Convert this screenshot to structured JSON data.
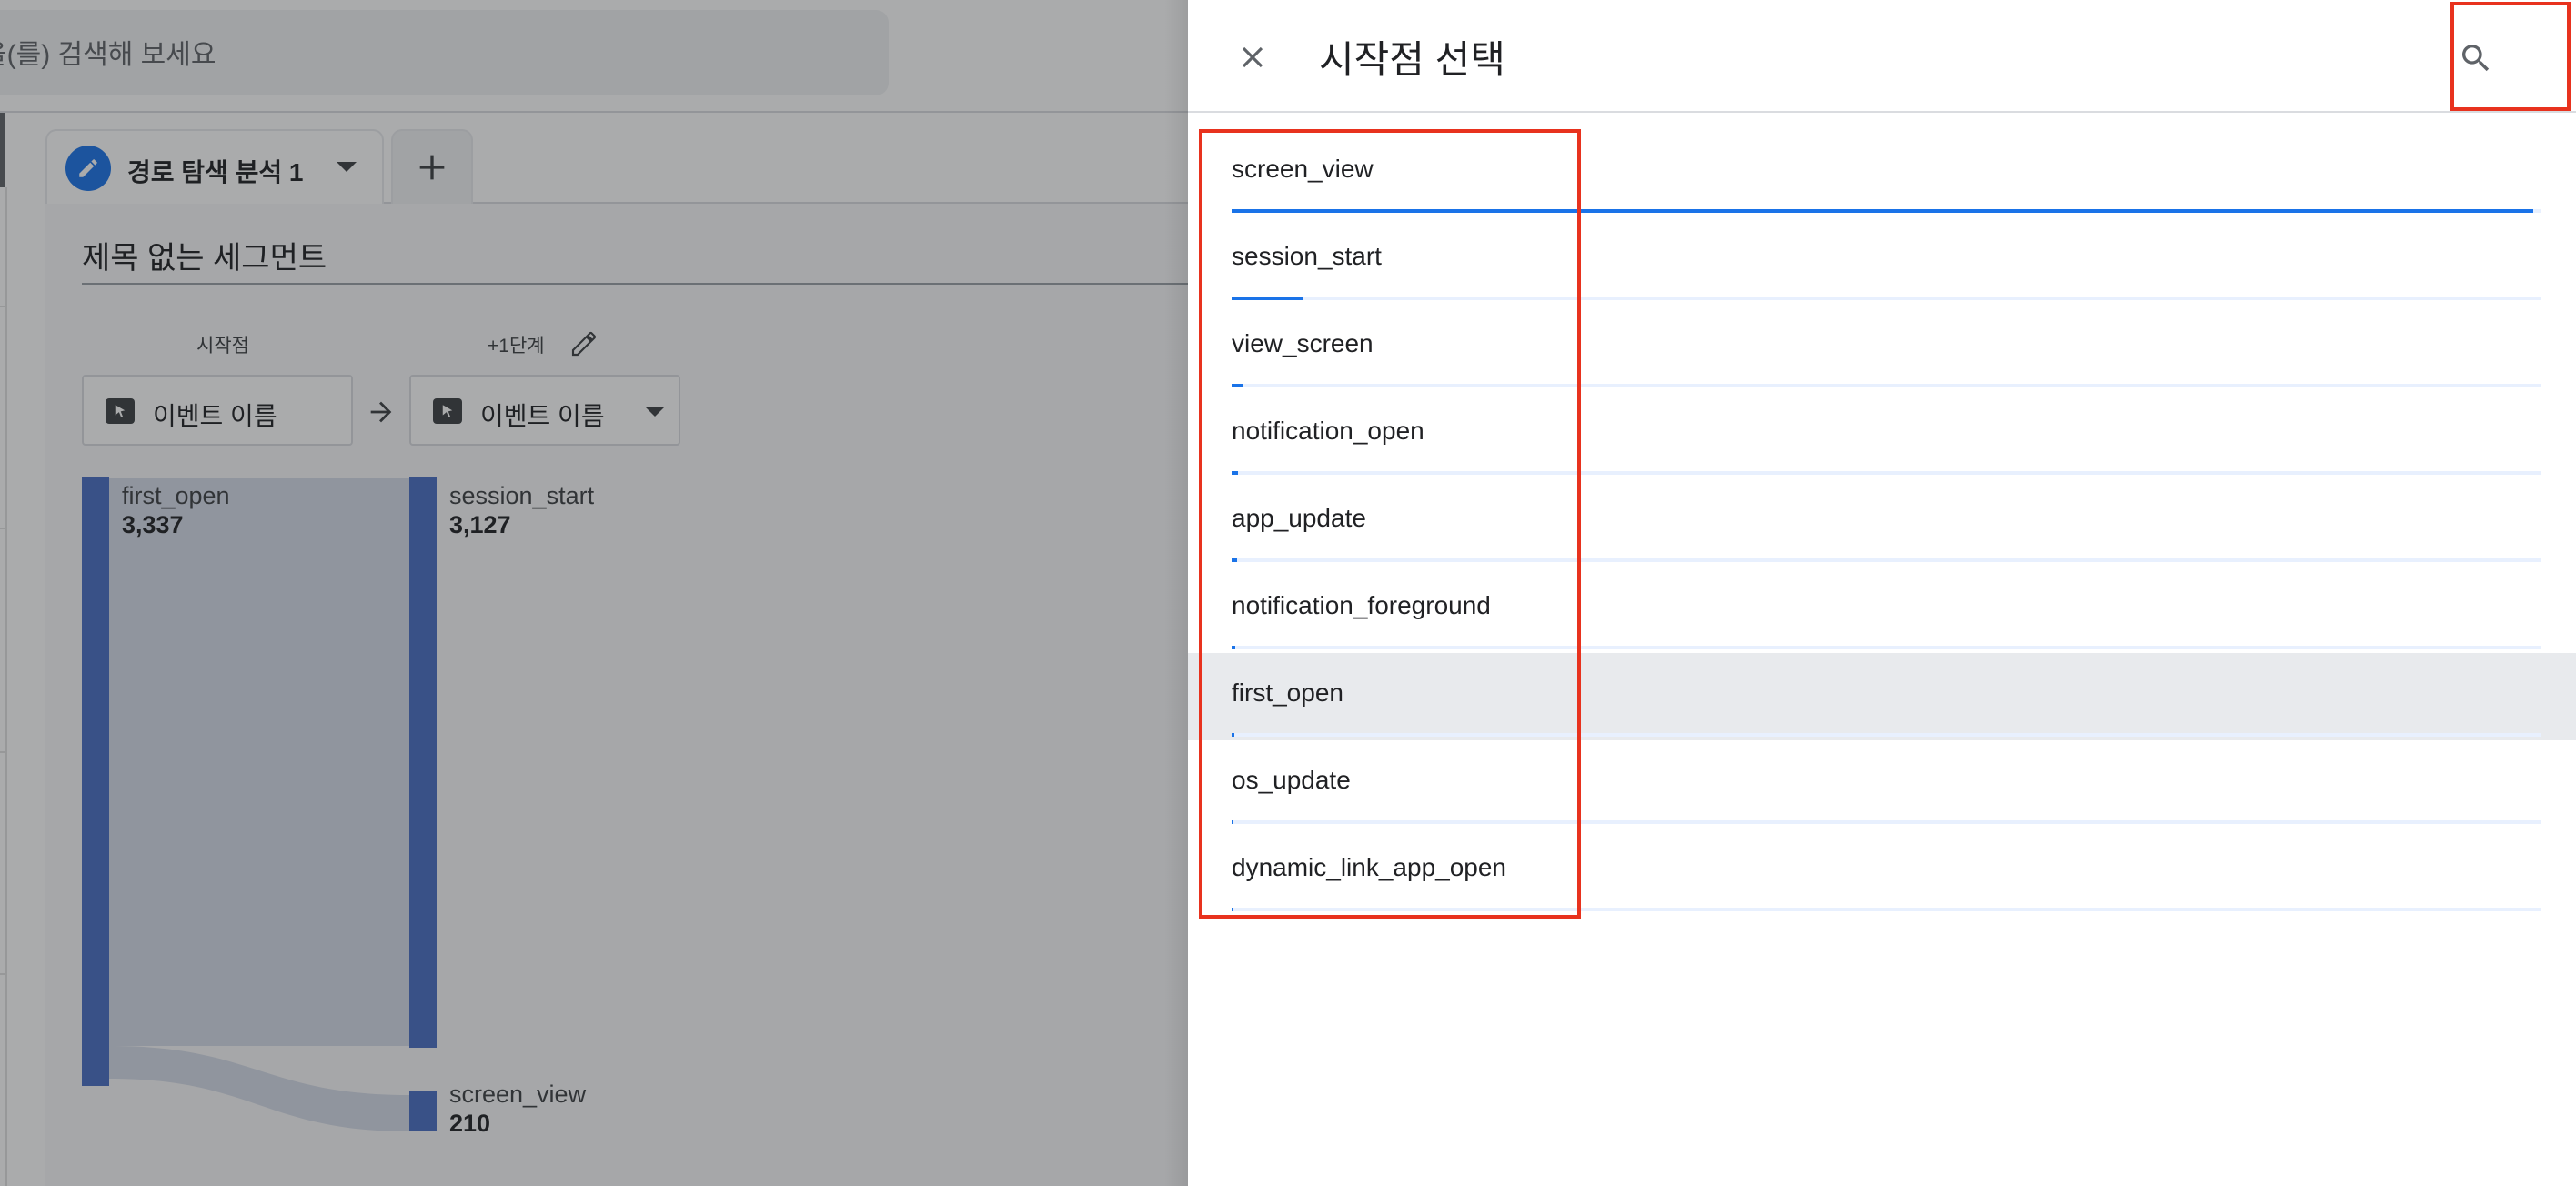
{
  "background": {
    "search_placeholder": "을(를) 검색해 보세요",
    "tab": {
      "label": "경로 탐색 분석 1"
    },
    "segment_title": "제목 없는 세그먼트",
    "steps": [
      {
        "label": "시작점",
        "dimension": "이벤트 이름"
      },
      {
        "label": "+1단계",
        "dimension": "이벤트 이름"
      }
    ],
    "nodes": {
      "first_open": {
        "name": "first_open",
        "value": "3,337"
      },
      "session_start": {
        "name": "session_start",
        "value": "3,127"
      },
      "screen_view": {
        "name": "screen_view",
        "value": "210"
      }
    }
  },
  "panel": {
    "title": "시작점 선택",
    "events": [
      {
        "name": "screen_view",
        "share": 0.994,
        "highlighted": false
      },
      {
        "name": "session_start",
        "share": 0.055,
        "highlighted": false
      },
      {
        "name": "view_screen",
        "share": 0.009,
        "highlighted": false
      },
      {
        "name": "notification_open",
        "share": 0.005,
        "highlighted": false
      },
      {
        "name": "app_update",
        "share": 0.004,
        "highlighted": false
      },
      {
        "name": "notification_foreground",
        "share": 0.003,
        "highlighted": false
      },
      {
        "name": "first_open",
        "share": 0.002,
        "highlighted": true
      },
      {
        "name": "os_update",
        "share": 0.001,
        "highlighted": false
      },
      {
        "name": "dynamic_link_app_open",
        "share": 0.0005,
        "highlighted": false
      }
    ]
  },
  "colors": {
    "accent": "#1a73e8",
    "annotation_red": "#e8321e",
    "node_blue": "#4a6fc4",
    "highlight_row": "#e8eaed"
  },
  "icons": {
    "close": "close-icon",
    "search": "search-icon",
    "pencil": "pencil-icon",
    "add": "plus-icon",
    "cursor": "cursor-icon",
    "arrow": "arrow-right-icon",
    "caret": "caret-down-icon"
  }
}
